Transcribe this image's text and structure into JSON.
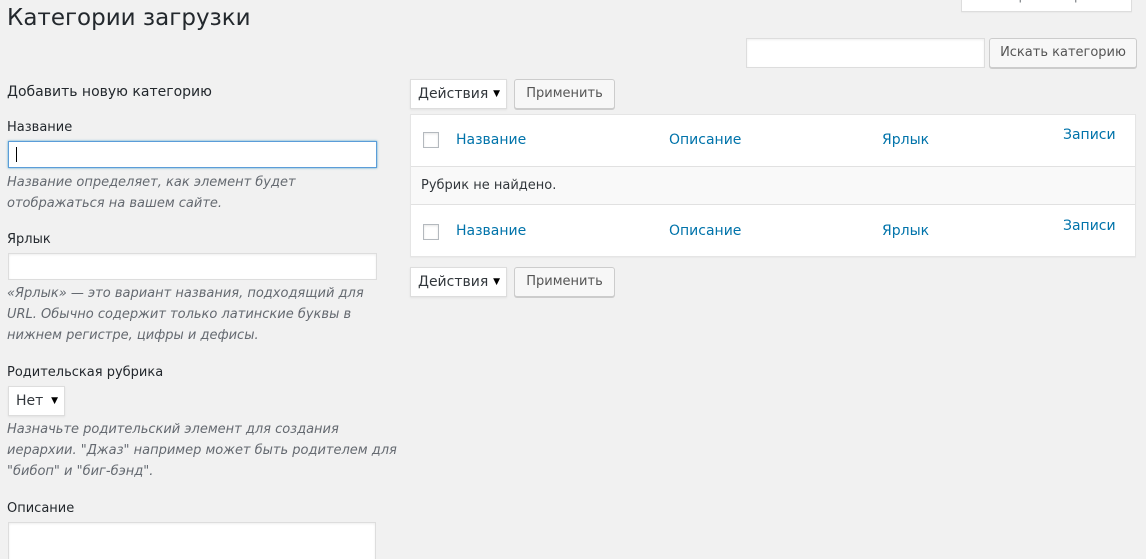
{
  "screen_options_label": "Настройки экрана",
  "page_title": "Категории загрузки",
  "search": {
    "input_value": "",
    "button_label": "Искать категорию"
  },
  "form": {
    "heading": "Добавить новую категорию",
    "name": {
      "label": "Название",
      "value": "",
      "hint": "Название определяет, как элемент будет отображаться на вашем сайте."
    },
    "slug": {
      "label": "Ярлык",
      "value": "",
      "hint": "«Ярлык» — это вариант названия, подходящий для URL. Обычно содержит только латинские буквы в нижнем регистре, цифры и дефисы."
    },
    "parent": {
      "label": "Родительская рубрика",
      "selected": "Нет",
      "hint": "Назначьте родительский элемент для создания иерархии. \"Джаз\" например может быть родителем для \"бибоп\" и \"биг-бэнд\"."
    },
    "description": {
      "label": "Описание",
      "value": ""
    }
  },
  "bulk_actions": {
    "top": {
      "selected": "Действия",
      "apply_label": "Применить"
    },
    "bottom": {
      "selected": "Действия",
      "apply_label": "Применить"
    }
  },
  "table": {
    "columns": [
      "Название",
      "Описание",
      "Ярлык",
      "Записи"
    ],
    "empty_message": "Рубрик не найдено."
  },
  "colors": {
    "background": "#f1f1f1",
    "link": "#0073aa",
    "focus_border": "#5b9dd9"
  }
}
